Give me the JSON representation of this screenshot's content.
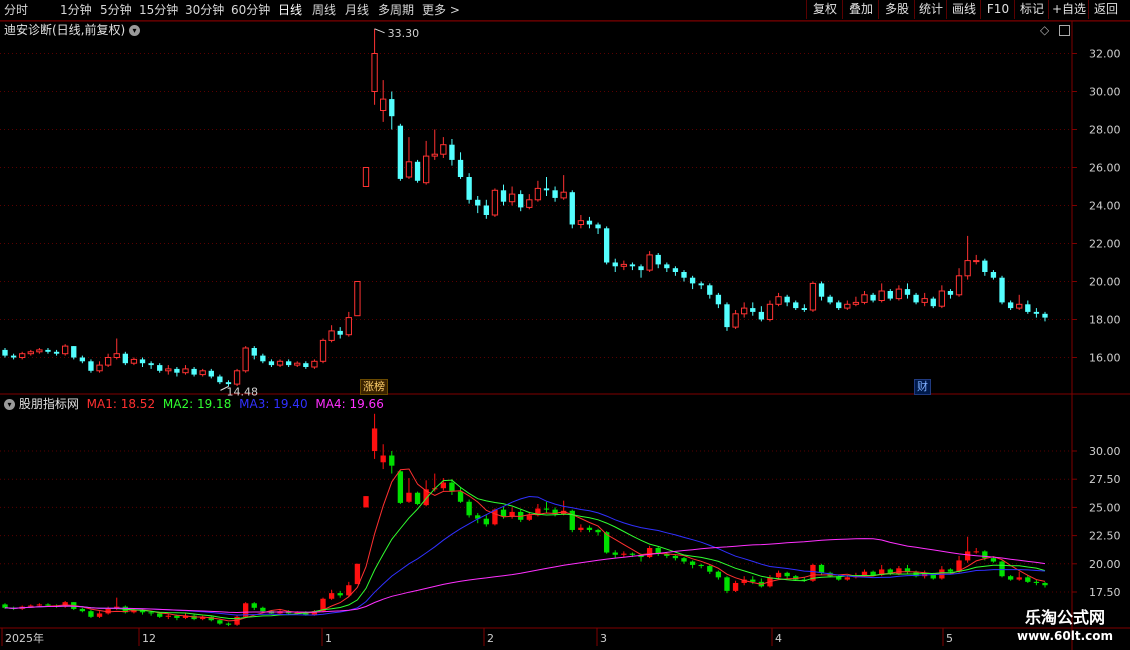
{
  "toolbar": {
    "periods": [
      "分时",
      "1分钟",
      "5分钟",
      "15分钟",
      "30分钟",
      "60分钟",
      "日线",
      "周线",
      "月线",
      "多周期",
      "更多 >"
    ],
    "active": "日线",
    "right_buttons": [
      "复权",
      "叠加",
      "多股",
      "统计",
      "画线",
      "F10",
      "标记",
      "+自选",
      "返回"
    ]
  },
  "main_panel": {
    "title": "迪安诊断(日线,前复权)",
    "y_ticks": [
      "32.00",
      "30.00",
      "28.00",
      "26.00",
      "24.00",
      "22.00",
      "20.00",
      "18.00",
      "16.00"
    ],
    "high_label": "33.30",
    "low_label": "14.48",
    "event_badges": [
      "涨榜",
      "财"
    ]
  },
  "indicator_panel": {
    "title": "股朋指标网",
    "ma": [
      {
        "label": "MA1: 18.52",
        "color": "#ff3030"
      },
      {
        "label": "MA2: 19.18",
        "color": "#30ff30"
      },
      {
        "label": "MA3: 19.40",
        "color": "#3030ff"
      },
      {
        "label": "MA4: 19.66",
        "color": "#ff30ff"
      }
    ],
    "y_ticks": [
      "30.00",
      "27.50",
      "25.00",
      "22.50",
      "20.00",
      "17.50"
    ]
  },
  "x_axis": [
    "2025年",
    "12",
    "1",
    "2",
    "3",
    "4",
    "5"
  ],
  "watermark": {
    "name": "乐淘公式网",
    "url": "www.60lt.com"
  },
  "colors": {
    "up": "#ff3232",
    "down": "#54ffff",
    "down_indicator": "#00e000",
    "up_indicator": "#ff1010",
    "grid": "#5a0000",
    "border": "#800000"
  },
  "chart_data": {
    "type": "candlestick",
    "candles": [
      [
        16.4,
        16.1,
        16.5,
        16.0
      ],
      [
        16.1,
        16.0,
        16.2,
        15.9
      ],
      [
        16.0,
        16.2,
        16.3,
        15.9
      ],
      [
        16.2,
        16.3,
        16.4,
        16.1
      ],
      [
        16.3,
        16.4,
        16.5,
        16.2
      ],
      [
        16.4,
        16.3,
        16.5,
        16.2
      ],
      [
        16.3,
        16.2,
        16.4,
        16.1
      ],
      [
        16.2,
        16.6,
        16.7,
        16.1
      ],
      [
        16.6,
        16.0,
        16.6,
        15.9
      ],
      [
        16.0,
        15.8,
        16.1,
        15.7
      ],
      [
        15.8,
        15.3,
        15.9,
        15.2
      ],
      [
        15.3,
        15.6,
        15.8,
        15.2
      ],
      [
        15.6,
        16.0,
        16.2,
        15.5
      ],
      [
        16.0,
        16.2,
        17.0,
        15.9
      ],
      [
        16.2,
        15.7,
        16.3,
        15.6
      ],
      [
        15.7,
        15.9,
        16.0,
        15.6
      ],
      [
        15.9,
        15.7,
        16.0,
        15.5
      ],
      [
        15.7,
        15.6,
        15.8,
        15.4
      ],
      [
        15.6,
        15.3,
        15.7,
        15.2
      ],
      [
        15.3,
        15.4,
        15.6,
        15.1
      ],
      [
        15.4,
        15.2,
        15.5,
        15.0
      ],
      [
        15.2,
        15.4,
        15.6,
        15.1
      ],
      [
        15.4,
        15.1,
        15.5,
        15.0
      ],
      [
        15.1,
        15.3,
        15.4,
        15.0
      ],
      [
        15.3,
        15.0,
        15.4,
        14.9
      ],
      [
        15.0,
        14.7,
        15.1,
        14.6
      ],
      [
        14.7,
        14.6,
        14.8,
        14.48
      ],
      [
        14.6,
        15.3,
        15.4,
        14.5
      ],
      [
        15.3,
        16.5,
        16.6,
        15.2
      ],
      [
        16.5,
        16.1,
        16.6,
        15.9
      ],
      [
        16.1,
        15.8,
        16.2,
        15.7
      ],
      [
        15.8,
        15.6,
        15.9,
        15.5
      ],
      [
        15.6,
        15.8,
        15.9,
        15.5
      ],
      [
        15.8,
        15.6,
        15.9,
        15.5
      ],
      [
        15.6,
        15.7,
        15.8,
        15.5
      ],
      [
        15.7,
        15.5,
        15.8,
        15.4
      ],
      [
        15.5,
        15.8,
        15.9,
        15.4
      ],
      [
        15.8,
        16.9,
        17.0,
        15.7
      ],
      [
        16.9,
        17.4,
        17.7,
        16.8
      ],
      [
        17.4,
        17.2,
        17.6,
        17.0
      ],
      [
        17.2,
        18.1,
        18.4,
        17.1
      ],
      [
        18.2,
        20.0,
        20.0,
        18.2
      ],
      [
        25.0,
        26.0,
        26.0,
        25.0
      ],
      [
        30.0,
        32.0,
        33.3,
        29.3
      ],
      [
        29.0,
        29.6,
        30.6,
        28.4
      ],
      [
        29.6,
        28.7,
        30.0,
        28.0
      ],
      [
        28.2,
        25.4,
        28.3,
        25.3
      ],
      [
        25.5,
        26.3,
        27.6,
        25.4
      ],
      [
        26.3,
        25.3,
        26.4,
        25.2
      ],
      [
        25.2,
        26.6,
        27.4,
        25.1
      ],
      [
        26.6,
        26.7,
        28.0,
        26.4
      ],
      [
        26.7,
        27.2,
        27.6,
        26.5
      ],
      [
        27.2,
        26.4,
        27.5,
        26.1
      ],
      [
        26.4,
        25.5,
        26.8,
        25.4
      ],
      [
        25.5,
        24.3,
        25.7,
        24.1
      ],
      [
        24.3,
        24.0,
        24.5,
        23.6
      ],
      [
        24.0,
        23.5,
        24.3,
        23.3
      ],
      [
        23.5,
        24.8,
        24.9,
        23.4
      ],
      [
        24.8,
        24.2,
        25.1,
        24.0
      ],
      [
        24.2,
        24.6,
        25.0,
        24.0
      ],
      [
        24.6,
        23.9,
        24.8,
        23.7
      ],
      [
        23.9,
        24.3,
        24.6,
        23.8
      ],
      [
        24.3,
        24.9,
        25.3,
        24.2
      ],
      [
        24.9,
        24.8,
        25.5,
        24.5
      ],
      [
        24.8,
        24.4,
        25.0,
        24.2
      ],
      [
        24.4,
        24.7,
        25.6,
        24.3
      ],
      [
        24.7,
        23.0,
        24.8,
        22.8
      ],
      [
        23.0,
        23.2,
        23.5,
        22.8
      ],
      [
        23.2,
        23.0,
        23.4,
        22.8
      ],
      [
        23.0,
        22.8,
        23.1,
        22.5
      ],
      [
        22.8,
        21.0,
        22.9,
        20.9
      ],
      [
        21.0,
        20.8,
        21.2,
        20.5
      ],
      [
        20.8,
        20.9,
        21.1,
        20.6
      ],
      [
        20.9,
        20.8,
        21.0,
        20.6
      ],
      [
        20.8,
        20.6,
        20.9,
        20.2
      ],
      [
        20.6,
        21.4,
        21.6,
        20.5
      ],
      [
        21.4,
        20.9,
        21.5,
        20.7
      ],
      [
        20.9,
        20.7,
        21.0,
        20.5
      ],
      [
        20.7,
        20.5,
        20.8,
        20.3
      ],
      [
        20.5,
        20.2,
        20.6,
        20.0
      ],
      [
        20.2,
        19.9,
        20.3,
        19.6
      ],
      [
        19.9,
        19.8,
        20.0,
        19.6
      ],
      [
        19.8,
        19.3,
        19.9,
        19.1
      ],
      [
        19.3,
        18.8,
        19.4,
        18.6
      ],
      [
        18.8,
        17.6,
        18.9,
        17.4
      ],
      [
        17.6,
        18.3,
        18.5,
        17.5
      ],
      [
        18.3,
        18.6,
        18.9,
        18.1
      ],
      [
        18.6,
        18.4,
        18.9,
        18.2
      ],
      [
        18.4,
        18.0,
        18.7,
        17.9
      ],
      [
        18.0,
        18.8,
        19.0,
        17.9
      ],
      [
        18.8,
        19.2,
        19.4,
        18.7
      ],
      [
        19.2,
        18.9,
        19.3,
        18.7
      ],
      [
        18.9,
        18.6,
        19.0,
        18.5
      ],
      [
        18.6,
        18.5,
        18.8,
        18.4
      ],
      [
        18.5,
        19.9,
        20.0,
        18.4
      ],
      [
        19.9,
        19.2,
        20.0,
        19.0
      ],
      [
        19.2,
        18.9,
        19.3,
        18.8
      ],
      [
        18.9,
        18.6,
        19.0,
        18.5
      ],
      [
        18.6,
        18.8,
        19.0,
        18.5
      ],
      [
        18.8,
        18.9,
        19.2,
        18.7
      ],
      [
        18.9,
        19.3,
        19.5,
        18.8
      ],
      [
        19.3,
        19.0,
        19.4,
        18.9
      ],
      [
        19.0,
        19.5,
        19.9,
        18.9
      ],
      [
        19.5,
        19.1,
        19.6,
        19.0
      ],
      [
        19.1,
        19.6,
        19.8,
        19.0
      ],
      [
        19.6,
        19.3,
        19.9,
        19.1
      ],
      [
        19.3,
        18.9,
        19.4,
        18.8
      ],
      [
        18.9,
        19.1,
        19.4,
        18.7
      ],
      [
        19.1,
        18.7,
        19.2,
        18.6
      ],
      [
        18.7,
        19.5,
        19.8,
        18.6
      ],
      [
        19.5,
        19.3,
        19.6,
        19.1
      ],
      [
        19.3,
        20.3,
        20.7,
        19.2
      ],
      [
        20.3,
        21.1,
        22.4,
        20.1
      ],
      [
        21.1,
        21.1,
        21.4,
        20.9
      ],
      [
        21.1,
        20.5,
        21.2,
        20.3
      ],
      [
        20.5,
        20.2,
        20.6,
        20.1
      ],
      [
        20.2,
        18.9,
        20.3,
        18.8
      ],
      [
        18.9,
        18.6,
        19.0,
        18.5
      ],
      [
        18.6,
        18.8,
        19.3,
        18.5
      ],
      [
        18.8,
        18.4,
        19.0,
        18.3
      ],
      [
        18.4,
        18.3,
        18.6,
        18.1
      ],
      [
        18.3,
        18.1,
        18.4,
        17.9
      ]
    ]
  }
}
